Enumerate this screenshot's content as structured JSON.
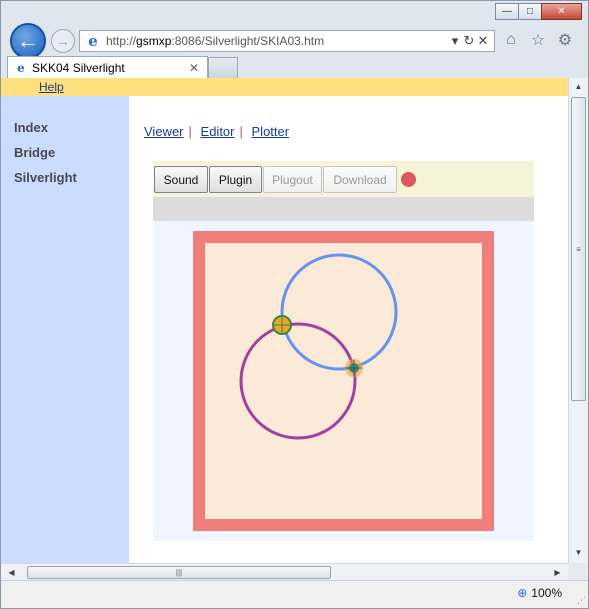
{
  "browser": {
    "address": {
      "prefix": "http://",
      "host": "gsmxp",
      "rest": ":8086/Silverlight/SKIA03.htm"
    },
    "tab_title": "SKK04 Silverlight",
    "zoom": "100%",
    "icons": {
      "back": "back-arrow-icon",
      "forward": "forward-arrow-icon",
      "home": "home-icon",
      "favorites": "star-icon",
      "tools": "gear-icon"
    }
  },
  "page": {
    "menu": {
      "help": "Help"
    },
    "sidebar": [
      {
        "label": "Index"
      },
      {
        "label": "Bridge"
      },
      {
        "label": "Silverlight"
      }
    ],
    "links": [
      {
        "label": "Viewer"
      },
      {
        "label": "Editor"
      },
      {
        "label": "Plotter"
      }
    ],
    "link_separator": "|",
    "toolbar": {
      "sound": "Sound",
      "plugin": "Plugin",
      "plugout": "Plugout",
      "download": "Download"
    },
    "colors": {
      "menubar": "#ffdf80",
      "sidebar": "#cbdcff",
      "frame": "#f07e7a",
      "canvas_fill": "#fbead8",
      "circle_blue": "#6495ed",
      "circle_purple": "#a040a0",
      "intersection_point": "#f0a030",
      "record_dot": "#d85a5a"
    }
  }
}
